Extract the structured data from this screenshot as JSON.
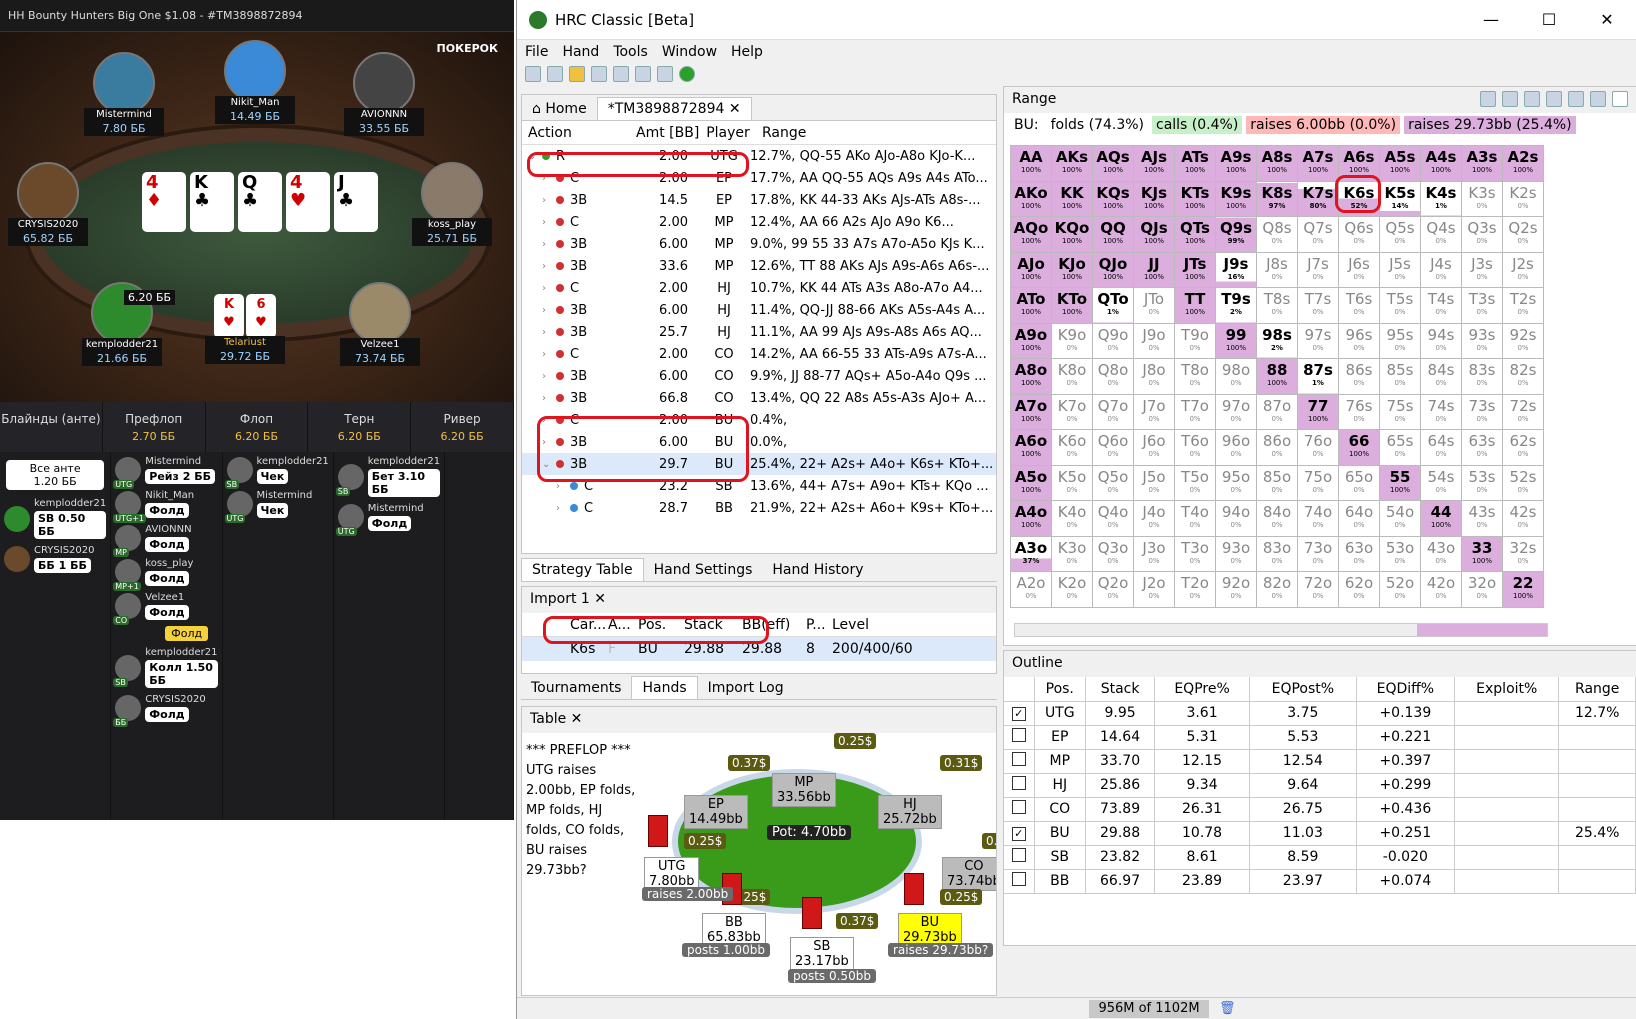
{
  "poker": {
    "title": "HH Bounty Hunters Big One $1.08 - #TM3898872894",
    "brand": "ПОКЕРОК",
    "seats": [
      {
        "name": "Mistermind",
        "stack": "7.80 ББ",
        "bet": "$0.25"
      },
      {
        "name": "Nikit_Man",
        "stack": "14.49 ББ",
        "bet": "$0.37"
      },
      {
        "name": "AVIONNN",
        "stack": "33.55 ББ",
        "bet": "$0.25"
      },
      {
        "name": "CRYSIS2020",
        "stack": "65.82 ББ",
        "bet": "$0.25"
      },
      {
        "name": "koss_play",
        "stack": "25.71 ББ",
        "bet": "$0.31"
      },
      {
        "name": "kemplodder21",
        "stack": "21.66 ББ",
        "bet": "$0.37"
      },
      {
        "name": "Telariust",
        "stack": "29.72 ББ",
        "bet": "$0.25"
      },
      {
        "name": "Velzee1",
        "stack": "73.74 ББ",
        "bet": "$0.37"
      }
    ],
    "board": [
      {
        "r": "4",
        "s": "♦",
        "c": "red"
      },
      {
        "r": "K",
        "s": "♣",
        "c": "blk"
      },
      {
        "r": "Q",
        "s": "♣",
        "c": "blk"
      },
      {
        "r": "4",
        "s": "♥",
        "c": "red"
      },
      {
        "r": "J",
        "s": "♣",
        "c": "blk"
      }
    ],
    "pot": "6.20 ББ",
    "streets": [
      {
        "name": "Блайнды (анте)",
        "val": ""
      },
      {
        "name": "Префлоп",
        "val": "2.70 ББ"
      },
      {
        "name": "Флоп",
        "val": "6.20 ББ"
      },
      {
        "name": "Терн",
        "val": "6.20 ББ"
      },
      {
        "name": "Ривер",
        "val": "6.20 ББ"
      }
    ],
    "blinds": {
      "ante": "Все анте\n1.20 ББ",
      "sb_name": "kemplodder21",
      "sb_act": "SB 0.50 ББ",
      "bb_name": "CRYSIS2020",
      "bb_act": "ББ 1 ББ"
    },
    "preflop": [
      {
        "name": "Mistermind",
        "pos": "UTG",
        "act": "Рейз 2 ББ"
      },
      {
        "name": "Nikit_Man",
        "pos": "UTG+1",
        "act": "Фолд"
      },
      {
        "name": "AVIONNN",
        "pos": "MP",
        "act": "Фолд"
      },
      {
        "name": "koss_play",
        "pos": "MP+1",
        "act": "Фолд"
      },
      {
        "name": "Velzee1",
        "pos": "CO",
        "act": "Фолд"
      },
      {
        "name": "kemplodder21",
        "pos": "SB",
        "act": "Колл 1.50 ББ"
      },
      {
        "name": "CRYSIS2020",
        "pos": "ББ",
        "act": "Фолд"
      }
    ],
    "fold_badge": "Фолд",
    "flop": [
      {
        "name": "kemplodder21",
        "pos": "SB",
        "act": "Чек"
      },
      {
        "name": "Mistermind",
        "pos": "UTG",
        "act": "Чек"
      }
    ],
    "turn": [
      {
        "name": "kemplodder21",
        "pos": "SB",
        "act": "Бет 3.10 ББ"
      },
      {
        "name": "Mistermind",
        "pos": "UTG",
        "act": "Фолд"
      }
    ]
  },
  "hrc": {
    "title": "HRC Classic [Beta]",
    "menu": [
      "File",
      "Hand",
      "Tools",
      "Window",
      "Help"
    ],
    "tabs": {
      "home": "Home",
      "hand": "*TM3898872894"
    },
    "tree_headers": [
      "Action",
      "Amt [BB]",
      "Player",
      "Range"
    ],
    "tree": [
      {
        "d": 0,
        "dot": "#2aa02a",
        "act": "R",
        "amt": "2.00",
        "pl": "UTG",
        "rg": "12.7%, QQ-55 AKo AJo-A8o KJo-K..."
      },
      {
        "d": 1,
        "dot": "#d03030",
        "act": "C",
        "amt": "2.00",
        "pl": "EP",
        "rg": "17.7%, AA QQ-55 AQs A9s A4s ATo..."
      },
      {
        "d": 1,
        "dot": "#d03030",
        "act": "3B",
        "amt": "14.5",
        "pl": "EP",
        "rg": "17.8%, KK 44-33 AKs AJs-ATs A8s-..."
      },
      {
        "d": 1,
        "dot": "#d03030",
        "act": "C",
        "amt": "2.00",
        "pl": "MP",
        "rg": "12.4%, AA 66 A2s AJo A9o K6..."
      },
      {
        "d": 1,
        "dot": "#d03030",
        "act": "3B",
        "amt": "6.00",
        "pl": "MP",
        "rg": "9.0%, 99 55 33 A7s A7o-A5o KJs K..."
      },
      {
        "d": 1,
        "dot": "#d03030",
        "act": "3B",
        "amt": "33.6",
        "pl": "MP",
        "rg": "12.6%, TT 88 AKs AJs A9s-A6s A6s-..."
      },
      {
        "d": 1,
        "dot": "#d03030",
        "act": "C",
        "amt": "2.00",
        "pl": "HJ",
        "rg": "10.7%, KK 44 ATs A3s A8o-A7o A4..."
      },
      {
        "d": 1,
        "dot": "#d03030",
        "act": "3B",
        "amt": "6.00",
        "pl": "HJ",
        "rg": "11.4%, QQ-JJ 88-66 AKs A5s-A4s A..."
      },
      {
        "d": 1,
        "dot": "#d03030",
        "act": "3B",
        "amt": "25.7",
        "pl": "HJ",
        "rg": "11.1%, AA 99 AJs A9s-A8s A6s AQ..."
      },
      {
        "d": 1,
        "dot": "#d03030",
        "act": "C",
        "amt": "2.00",
        "pl": "CO",
        "rg": "14.2%, AA 66-55 33 ATs-A9s A7s-A..."
      },
      {
        "d": 1,
        "dot": "#d03030",
        "act": "3B",
        "amt": "6.00",
        "pl": "CO",
        "rg": "9.9%, JJ 88-77 AQs+ A5o-A4o Q9s ..."
      },
      {
        "d": 1,
        "dot": "#d03030",
        "act": "3B",
        "amt": "66.8",
        "pl": "CO",
        "rg": "13.4%, QQ 22 A8s A5s-A3s AJo+ A..."
      },
      {
        "d": 1,
        "dot": "#d03030",
        "act": "C",
        "amt": "2.00",
        "pl": "BU",
        "rg": "0.4%,"
      },
      {
        "d": 1,
        "dot": "#d03030",
        "act": "3B",
        "amt": "6.00",
        "pl": "BU",
        "rg": "0.0%,"
      },
      {
        "d": 1,
        "dot": "#d03030",
        "act": "3B",
        "amt": "29.7",
        "pl": "BU",
        "rg": "25.4%, 22+ A2s+ A4o+ K6s+ KTo+...",
        "sel": true
      },
      {
        "d": 2,
        "dot": "#3a8ad8",
        "act": "C",
        "amt": "23.2",
        "pl": "SB",
        "rg": "13.6%, 44+ A7s+ A9o+ KTs+ KQo ..."
      },
      {
        "d": 2,
        "dot": "#3a8ad8",
        "act": "C",
        "amt": "28.7",
        "pl": "BB",
        "rg": "21.9%, 22+ A2s+ A6o+ K9s+ KTo+..."
      }
    ],
    "bottom_tabs": [
      "Strategy Table",
      "Hand Settings",
      "Hand History"
    ],
    "import": {
      "title": "Import 1",
      "headers": [
        "Car...",
        "A...",
        "Pos.",
        "Stack",
        "BB(eff)",
        "P...",
        "Level"
      ],
      "row": [
        "K6s",
        "F",
        "BU",
        "29.88",
        "29.88",
        "8",
        "200/400/60"
      ]
    },
    "import_tabs": [
      "Tournaments",
      "Hands",
      "Import Log"
    ],
    "table": {
      "title": "Table",
      "text": "*** PREFLOP ***\nUTG raises 2.00bb, EP folds, MP folds, HJ folds, CO folds, BU raises 29.73bb?",
      "pot": "Pot:   4.70bb",
      "seats": {
        "mp": "MP\n33.56bb",
        "ep": "EP\n14.49bb",
        "hj": "HJ\n25.72bb",
        "utg": "UTG\n7.80bb",
        "co": "CO\n73.74bb",
        "bb": "BB\n65.83bb",
        "sb": "SB\n23.17bb",
        "bu": "BU\n29.73bb"
      },
      "chips": {
        "mp": "0.25$",
        "ep": "0.37$",
        "hj": "0.31$",
        "utg": "0.25$",
        "co": "0.37$",
        "bb": "0.25$",
        "sb": "0.37$",
        "bu": "0.25$"
      },
      "labels": {
        "utg": "raises 2.00bb",
        "bb": "posts 1.00bb",
        "sb": "posts 0.50bb",
        "bu": "raises 29.73bb?"
      }
    },
    "range": {
      "title": "Range",
      "lead": "BU:",
      "folds": "folds (74.3%)",
      "calls": "calls (0.4%)",
      "raise1": "raises 6.00bb (0.0%)",
      "raise2": "raises 29.73bb (25.4%)"
    },
    "outline": {
      "title": "Outline",
      "headers": [
        "Pos.",
        "Stack",
        "EQPre%",
        "EQPost%",
        "EQDiff%",
        "Exploit%",
        "Range"
      ],
      "rows": [
        {
          "chk": true,
          "pos": "UTG",
          "stack": "9.95",
          "pre": "3.61",
          "post": "3.75",
          "diff": "+0.139",
          "exp": "",
          "rng": "12.7%"
        },
        {
          "chk": false,
          "pos": "EP",
          "stack": "14.64",
          "pre": "5.31",
          "post": "5.53",
          "diff": "+0.221",
          "exp": "",
          "rng": ""
        },
        {
          "chk": false,
          "pos": "MP",
          "stack": "33.70",
          "pre": "12.15",
          "post": "12.54",
          "diff": "+0.397",
          "exp": "",
          "rng": ""
        },
        {
          "chk": false,
          "pos": "HJ",
          "stack": "25.86",
          "pre": "9.34",
          "post": "9.64",
          "diff": "+0.299",
          "exp": "",
          "rng": ""
        },
        {
          "chk": false,
          "pos": "CO",
          "stack": "73.89",
          "pre": "26.31",
          "post": "26.75",
          "diff": "+0.436",
          "exp": "",
          "rng": ""
        },
        {
          "chk": true,
          "pos": "BU",
          "stack": "29.88",
          "pre": "10.78",
          "post": "11.03",
          "diff": "+0.251",
          "exp": "",
          "rng": "25.4%"
        },
        {
          "chk": false,
          "pos": "SB",
          "stack": "23.82",
          "pre": "8.61",
          "post": "8.59",
          "diff": "-0.020",
          "exp": "",
          "rng": ""
        },
        {
          "chk": false,
          "pos": "BB",
          "stack": "66.97",
          "pre": "23.89",
          "post": "23.97",
          "diff": "+0.074",
          "exp": "",
          "rng": ""
        }
      ]
    },
    "memory": "956M of 1102M",
    "grid": [
      [
        "AA|100",
        "AKs|100",
        "AQs|100",
        "AJs|100",
        "ATs|100",
        "A9s|100",
        "A8s|100",
        "A7s|100",
        "A6s|100",
        "A5s|100",
        "A4s|100",
        "A3s|100",
        "A2s|100"
      ],
      [
        "AKo|100",
        "KK|100",
        "KQs|100",
        "KJs|100",
        "KTs|100",
        "K9s|100",
        "K8s|97",
        "K7s|80",
        "K6s|52",
        "K5s|14",
        "K4s|1",
        "K3s|0",
        "K2s|0"
      ],
      [
        "AQo|100",
        "KQo|100",
        "QQ|100",
        "QJs|100",
        "QTs|100",
        "Q9s|99",
        "Q8s|0",
        "Q7s|0",
        "Q6s|0",
        "Q5s|0",
        "Q4s|0",
        "Q3s|0",
        "Q2s|0"
      ],
      [
        "AJo|100",
        "KJo|100",
        "QJo|100",
        "JJ|100",
        "JTs|100",
        "J9s|16",
        "J8s|0",
        "J7s|0",
        "J6s|0",
        "J5s|0",
        "J4s|0",
        "J3s|0",
        "J2s|0"
      ],
      [
        "ATo|100",
        "KTo|100",
        "QTo|1",
        "JTo|0",
        "TT|100",
        "T9s|2",
        "T8s|0",
        "T7s|0",
        "T6s|0",
        "T5s|0",
        "T4s|0",
        "T3s|0",
        "T2s|0"
      ],
      [
        "A9o|100",
        "K9o|0",
        "Q9o|0",
        "J9o|0",
        "T9o|0",
        "99|100",
        "98s|2",
        "97s|0",
        "96s|0",
        "95s|0",
        "94s|0",
        "93s|0",
        "92s|0"
      ],
      [
        "A8o|100",
        "K8o|0",
        "Q8o|0",
        "J8o|0",
        "T8o|0",
        "98o|0",
        "88|100",
        "87s|1",
        "86s|0",
        "85s|0",
        "84s|0",
        "83s|0",
        "82s|0"
      ],
      [
        "A7o|100",
        "K7o|0",
        "Q7o|0",
        "J7o|0",
        "T7o|0",
        "97o|0",
        "87o|0",
        "77|100",
        "76s|0",
        "75s|0",
        "74s|0",
        "73s|0",
        "72s|0"
      ],
      [
        "A6o|100",
        "K6o|0",
        "Q6o|0",
        "J6o|0",
        "T6o|0",
        "96o|0",
        "86o|0",
        "76o|0",
        "66|100",
        "65s|0",
        "64s|0",
        "63s|0",
        "62s|0"
      ],
      [
        "A5o|100",
        "K5o|0",
        "Q5o|0",
        "J5o|0",
        "T5o|0",
        "95o|0",
        "85o|0",
        "75o|0",
        "65o|0",
        "55|100",
        "54s|0",
        "53s|0",
        "52s|0"
      ],
      [
        "A4o|100",
        "K4o|0",
        "Q4o|0",
        "J4o|0",
        "T4o|0",
        "94o|0",
        "84o|0",
        "74o|0",
        "64o|0",
        "54o|0",
        "44|100",
        "43s|0",
        "42s|0"
      ],
      [
        "A3o|37",
        "K3o|0",
        "Q3o|0",
        "J3o|0",
        "T3o|0",
        "93o|0",
        "83o|0",
        "73o|0",
        "63o|0",
        "53o|0",
        "43o|0",
        "33|100",
        "32s|0"
      ],
      [
        "A2o|0",
        "K2o|0",
        "Q2o|0",
        "J2o|0",
        "T2o|0",
        "92o|0",
        "82o|0",
        "72o|0",
        "62o|0",
        "52o|0",
        "42o|0",
        "32o|0",
        "22|100"
      ]
    ]
  }
}
